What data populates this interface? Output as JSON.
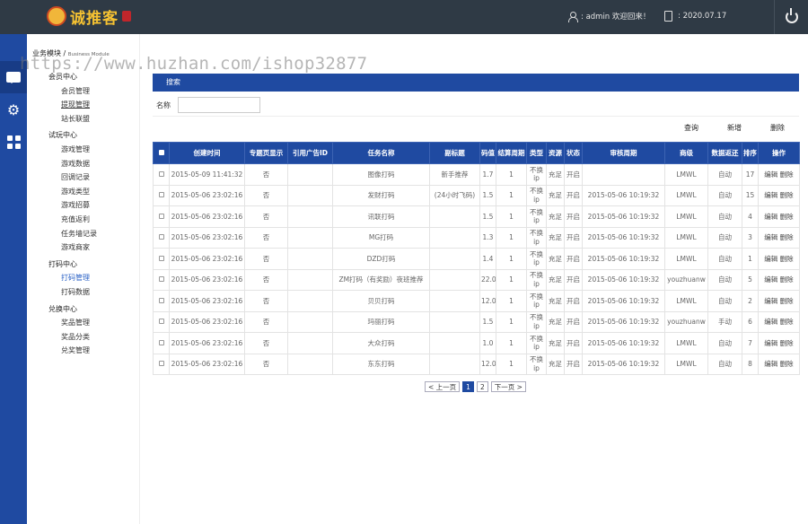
{
  "header": {
    "logo_text": "诚推客",
    "user_label": ": admin 欢迎回来！",
    "date_label": ": 2020.07.17"
  },
  "submenu": {
    "crumb_title": "业务模块",
    "crumb_sep": " / ",
    "crumb_sub": "Business Module",
    "groups": [
      {
        "label": "会员中心",
        "items": [
          "会员管理",
          "提现管理",
          "站长联盟"
        ]
      },
      {
        "label": "试玩中心",
        "items": [
          "游戏管理",
          "游戏数据",
          "回调记录",
          "游戏类型",
          "游戏招募",
          "充值返利",
          "任务墙记录",
          "游戏商家"
        ]
      },
      {
        "label": "打码中心",
        "items": [
          "打码管理",
          "打码数据"
        ]
      },
      {
        "label": "兑换中心",
        "items": [
          "奖品管理",
          "奖品分类",
          "兑奖管理"
        ]
      }
    ]
  },
  "watermark": "https://www.huzhan.com/ishop32877",
  "panel": {
    "title": "搜索",
    "search_label": "名称",
    "search_value": "",
    "query_btn": "查询",
    "add_btn": "新增",
    "delete_btn": "删除"
  },
  "table": {
    "columns": [
      "",
      "创建时间",
      "专题页显示",
      "引用广告ID",
      "任务名称",
      "副标题",
      "码值",
      "结算周期",
      "类型",
      "资源",
      "状态",
      "审核周期",
      "商级",
      "数据返还",
      "排序",
      "操作"
    ],
    "rows": [
      [
        "",
        "2015-05-09 11:41:32",
        "否",
        "",
        "图像打码",
        "新手推荐",
        "1.7",
        "1",
        "不换ip",
        "充足",
        "开启",
        "",
        "LMWL",
        "自动",
        "17",
        "编辑 删除"
      ],
      [
        "",
        "2015-05-06 23:02:16",
        "否",
        "",
        "发财打码",
        "(24小时飞码)",
        "1.5",
        "1",
        "不换ip",
        "充足",
        "开启",
        "2015-05-06 10:19:32",
        "LMWL",
        "自动",
        "15",
        "编辑 删除"
      ],
      [
        "",
        "2015-05-06 23:02:16",
        "否",
        "",
        "讯联打码",
        "",
        "1.5",
        "1",
        "不换ip",
        "充足",
        "开启",
        "2015-05-06 10:19:32",
        "LMWL",
        "自动",
        "4",
        "编辑 删除"
      ],
      [
        "",
        "2015-05-06 23:02:16",
        "否",
        "",
        "MG打码",
        "",
        "1.3",
        "1",
        "不换ip",
        "充足",
        "开启",
        "2015-05-06 10:19:32",
        "LMWL",
        "自动",
        "3",
        "编辑 删除"
      ],
      [
        "",
        "2015-05-06 23:02:16",
        "否",
        "",
        "DZD打码",
        "",
        "1.4",
        "1",
        "不换ip",
        "充足",
        "开启",
        "2015-05-06 10:19:32",
        "LMWL",
        "自动",
        "1",
        "编辑 删除"
      ],
      [
        "",
        "2015-05-06 23:02:16",
        "否",
        "",
        "ZM打码（有奖励）夜班推荐",
        "",
        "22.0",
        "1",
        "不换ip",
        "充足",
        "开启",
        "2015-05-06 10:19:32",
        "youzhuanw",
        "自动",
        "5",
        "编辑 删除"
      ],
      [
        "",
        "2015-05-06 23:02:16",
        "否",
        "",
        "贝贝打码",
        "",
        "12.0",
        "1",
        "不换ip",
        "充足",
        "开启",
        "2015-05-06 10:19:32",
        "LMWL",
        "自动",
        "2",
        "编辑 删除"
      ],
      [
        "",
        "2015-05-06 23:02:16",
        "否",
        "",
        "玛丽打码",
        "",
        "1.5",
        "1",
        "不换ip",
        "充足",
        "开启",
        "2015-05-06 10:19:32",
        "youzhuanw",
        "手动",
        "6",
        "编辑 删除"
      ],
      [
        "",
        "2015-05-06 23:02:16",
        "否",
        "",
        "大众打码",
        "",
        "1.0",
        "1",
        "不换ip",
        "充足",
        "开启",
        "2015-05-06 10:19:32",
        "LMWL",
        "自动",
        "7",
        "编辑 删除"
      ],
      [
        "",
        "2015-05-06 23:02:16",
        "否",
        "",
        "东东打码",
        "",
        "12.0",
        "1",
        "不换ip",
        "充足",
        "开启",
        "2015-05-06 10:19:32",
        "LMWL",
        "自动",
        "8",
        "编辑 删除"
      ]
    ]
  },
  "pager": {
    "prev": "< 上一页",
    "pages": [
      "1",
      "2"
    ],
    "current": "1",
    "next": "下一页 >"
  },
  "colors": {
    "topbar": "#2f3a45",
    "primary": "#1f4aa1",
    "active_link": "#2b62c6"
  }
}
